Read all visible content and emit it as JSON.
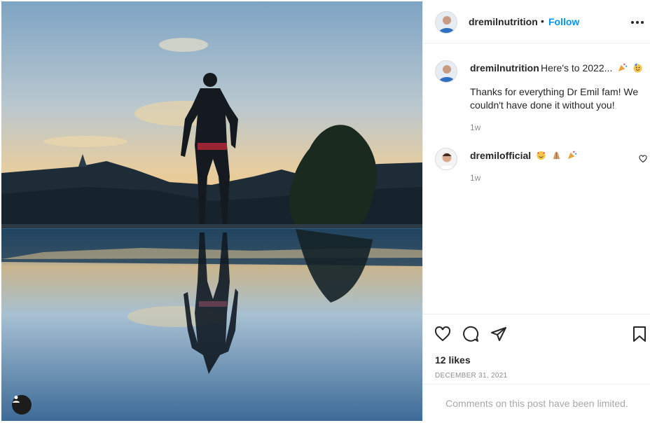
{
  "post": {
    "author": "dremilnutrition",
    "follow_label": "Follow",
    "separator": "•",
    "caption_head": "Here's to 2022...",
    "caption_body": "Thanks for everything Dr Emil fam! We couldn't have done it without you!",
    "caption_time": "1w",
    "likes": "12 likes",
    "date": "DECEMBER 31, 2021",
    "comments_limited": "Comments on this post have been limited."
  },
  "comments": [
    {
      "user": "dremilofficial",
      "time": "1w"
    }
  ],
  "colors": {
    "link_blue": "#0095f6",
    "text": "#262626",
    "muted": "#8e8e8e",
    "border": "#efefef"
  },
  "icons": [
    "more-options-icon",
    "heart-icon",
    "comment-icon",
    "share-icon",
    "bookmark-icon",
    "user-tag-icon"
  ]
}
